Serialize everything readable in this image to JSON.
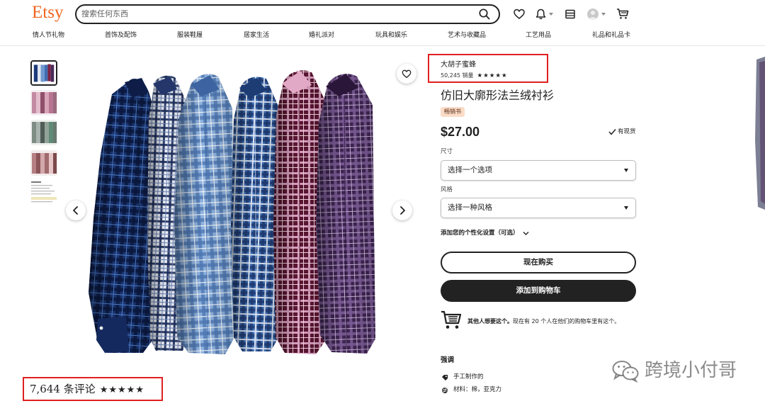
{
  "brand": {
    "logo": "Etsy"
  },
  "header": {
    "search_placeholder": "搜索任何东西",
    "icons": {
      "search": "search-icon",
      "favorites": "heart-icon",
      "notifications": "bell-icon",
      "registry": "gift-registry-icon",
      "account": "avatar",
      "cart": "cart-icon"
    }
  },
  "nav": {
    "items": [
      "情人节礼物",
      "首饰及配饰",
      "服装鞋履",
      "居家生活",
      "婚礼派对",
      "玩具和娱乐",
      "艺术与收藏品",
      "工艺用品",
      "礼品和礼品卡"
    ]
  },
  "gallery": {
    "reviews": {
      "count_label": "7,644 条评论",
      "stars": "★★★★★"
    }
  },
  "shop": {
    "name": "大胡子蜜蜂",
    "sales": "50,245 销量",
    "stars": "★★★★★"
  },
  "product": {
    "title": "仿旧大廓形法兰绒衬衫",
    "badge": "畅销书",
    "price": "$27.00",
    "stock": "有现货"
  },
  "options": [
    {
      "label": "尺寸",
      "placeholder": "选择一个选项"
    },
    {
      "label": "风格",
      "placeholder": "选择一种风格"
    }
  ],
  "personalization": "添加您的个性化设置（可选）",
  "buttons": {
    "buy_now": "现在购买",
    "add_to_cart": "添加到购物车"
  },
  "demand": {
    "bold": "其他人想要这个。",
    "text": "现在有 20 个人在他们的购物车里有这个。"
  },
  "highlights": {
    "title": "强调",
    "items": [
      {
        "icon": "handmade-icon",
        "text": "手工制作的"
      },
      {
        "icon": "yarn-icon",
        "text": "材料：棉，亚克力"
      }
    ]
  },
  "watermark": {
    "text": "跨境小付哥",
    "icon": "wechat-icon"
  },
  "colors": {
    "accent": "#f1641e",
    "highlight_box": "#e02020",
    "badge_bg": "#fadcc8",
    "button_dark": "#222222"
  }
}
